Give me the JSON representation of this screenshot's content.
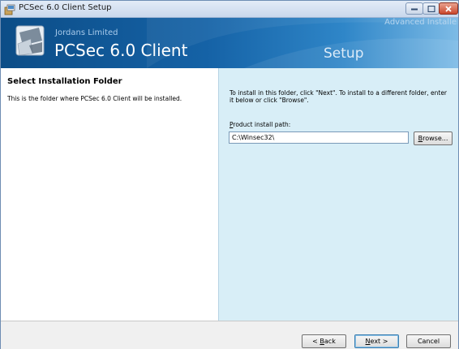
{
  "window": {
    "title": "PCSec 6.0 Client Setup",
    "controls": [
      "minimize",
      "maximize",
      "close"
    ]
  },
  "banner": {
    "company": "Jordans Limited",
    "product": "PCSec 6.0 Client",
    "step": "Setup",
    "watermark": "Advanced Installe"
  },
  "left": {
    "heading": "Select Installation Folder",
    "description": "This is the folder where PCSec 6.0 Client will be installed."
  },
  "right": {
    "instruction": "To install in this folder, click \"Next\". To install to a different folder, enter it below or click \"Browse\".",
    "path_label_access": "P",
    "path_label_rest": "roduct install path:",
    "path_value": "C:\\Winsec32\\",
    "browse_access": "B",
    "browse_rest": "rowse..."
  },
  "footer": {
    "back_prefix": "< ",
    "back_access": "B",
    "back_rest": "ack",
    "next_access": "N",
    "next_rest": "ext >",
    "cancel": "Cancel"
  },
  "colors": {
    "banner_dark": "#0c4d87",
    "banner_light": "#7dbbe6",
    "right_panel": "#d8eef7",
    "close_button": "#c9462b"
  },
  "icons": [
    "installer-app-icon",
    "minimize-icon",
    "maximize-icon",
    "close-icon",
    "product-logo-icon"
  ]
}
